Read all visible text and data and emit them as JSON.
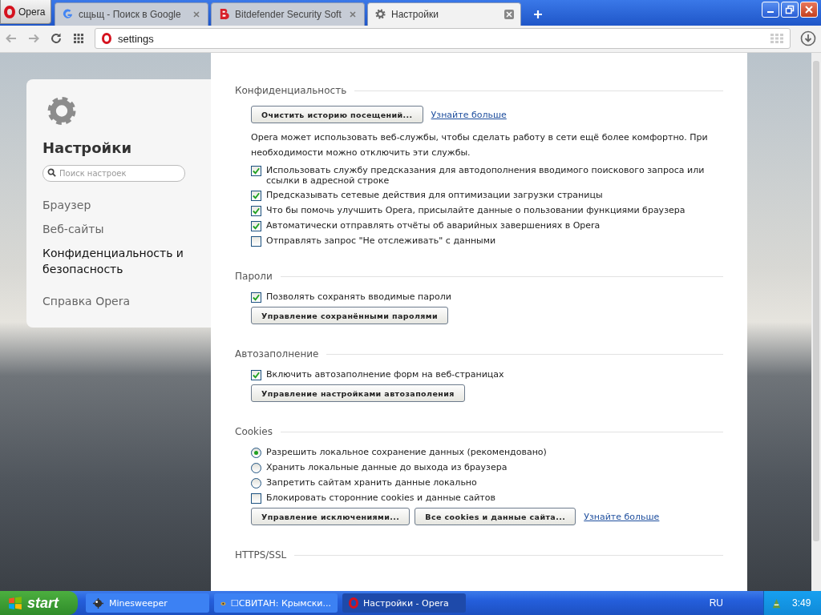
{
  "browser": {
    "menu_label": "Opera",
    "tabs": [
      {
        "title": "сщьщ - Поиск в Google",
        "selected": false
      },
      {
        "title": "Bitdefender Security Soft",
        "selected": false
      },
      {
        "title": "Настройки",
        "selected": true
      }
    ],
    "address": "settings"
  },
  "sidebar": {
    "title": "Настройки",
    "search": {
      "placeholder": "Поиск настроек"
    },
    "items": [
      {
        "label": "Браузер",
        "selected": false
      },
      {
        "label": "Веб-сайты",
        "selected": false
      },
      {
        "label": "Конфиденциальность и безопасность",
        "selected": true
      },
      {
        "label": "Справка Opera",
        "selected": false
      }
    ]
  },
  "sections": [
    {
      "title": "Конфиденциальность",
      "items": [
        {
          "kind": "buttons",
          "buttons": [
            "Очистить историю посещений..."
          ],
          "link": "Узнайте больше"
        },
        {
          "kind": "text",
          "text": "Opera может использовать веб-службы, чтобы сделать работу в сети ещё более комфортно. При необходимости можно отключить эти службы."
        },
        {
          "kind": "checkbox",
          "label": "Использовать службу предсказания для автодополнения вводимого поискового запроса или ссылки в адресной строке",
          "checked": true
        },
        {
          "kind": "checkbox",
          "label": "Предсказывать сетевые действия для оптимизации загрузки страницы",
          "checked": true
        },
        {
          "kind": "checkbox",
          "label": "Что бы помочь улучшить Opera, присылайте данные о пользовании функциями браузера",
          "checked": true
        },
        {
          "kind": "checkbox",
          "label": "Автоматически отправлять отчёты об аварийных завершениях в Opera",
          "checked": true
        },
        {
          "kind": "checkbox",
          "label": "Отправлять запрос \"Не отслеживать\" с данными",
          "checked": false
        }
      ]
    },
    {
      "title": "Пароли",
      "items": [
        {
          "kind": "checkbox",
          "label": "Позволять сохранять вводимые пароли",
          "checked": true
        },
        {
          "kind": "buttons",
          "buttons": [
            "Управление сохранёнными паролями"
          ]
        }
      ]
    },
    {
      "title": "Автозаполнение",
      "items": [
        {
          "kind": "checkbox",
          "label": "Включить автозаполнение форм на веб-страницах",
          "checked": true
        },
        {
          "kind": "buttons",
          "buttons": [
            "Управление настройками автозаполения"
          ]
        }
      ]
    },
    {
      "title": "Cookies",
      "items": [
        {
          "kind": "radio",
          "label": "Разрешить локальное сохранение данных (рекомендовано)",
          "selected": true
        },
        {
          "kind": "radio",
          "label": "Хранить локальные данные до выхода из браузера",
          "selected": false
        },
        {
          "kind": "radio",
          "label": "Запретить сайтам хранить данные локально",
          "selected": false
        },
        {
          "kind": "checkbox",
          "label": "Блокировать сторонние cookies и данные сайтов",
          "checked": false
        },
        {
          "kind": "buttons",
          "buttons": [
            "Управление исключениями...",
            "Все cookies и данные сайта..."
          ],
          "link": "Узнайте больше"
        }
      ]
    },
    {
      "title": "HTTPS/SSL"
    }
  ],
  "taskbar": {
    "start": "start",
    "tasks": [
      {
        "label": "Minesweeper",
        "selected": false
      },
      {
        "label": "☐СВИТАН: Крымски...",
        "selected": false
      },
      {
        "label": "Настройки - Opera",
        "selected": true
      }
    ],
    "language": "RU",
    "clock": "3:49"
  }
}
